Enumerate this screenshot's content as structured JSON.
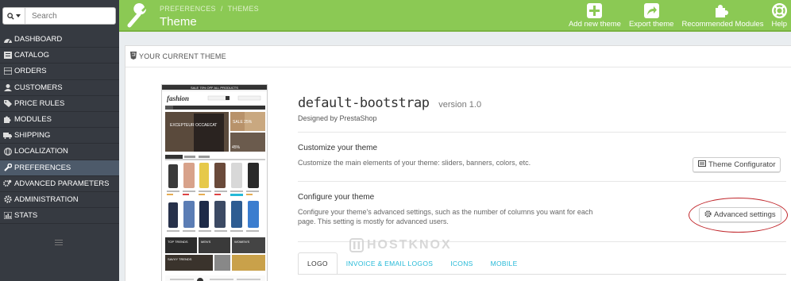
{
  "search": {
    "placeholder": "Search"
  },
  "sidebar": {
    "items": [
      {
        "label": "DASHBOARD",
        "icon": "dashboard-icon"
      },
      {
        "label": "CATALOG",
        "icon": "catalog-icon"
      },
      {
        "label": "ORDERS",
        "icon": "orders-icon"
      },
      {
        "label": "CUSTOMERS",
        "icon": "customers-icon"
      },
      {
        "label": "PRICE RULES",
        "icon": "tag-icon"
      },
      {
        "label": "MODULES",
        "icon": "puzzle-icon"
      },
      {
        "label": "SHIPPING",
        "icon": "truck-icon"
      },
      {
        "label": "LOCALIZATION",
        "icon": "globe-icon"
      },
      {
        "label": "PREFERENCES",
        "icon": "wrench-icon",
        "active": true
      },
      {
        "label": "ADVANCED PARAMETERS",
        "icon": "cogs-icon"
      },
      {
        "label": "ADMINISTRATION",
        "icon": "cog-icon"
      },
      {
        "label": "STATS",
        "icon": "bar-chart-icon"
      }
    ]
  },
  "header": {
    "breadcrumb": [
      "PREFERENCES",
      "THEMES"
    ],
    "title": "Theme",
    "toolbar": [
      {
        "label": "Add new theme",
        "icon": "plus-square-icon"
      },
      {
        "label": "Export theme",
        "icon": "export-icon"
      },
      {
        "label": "Recommended Modules",
        "icon": "puzzle-piece-icon"
      },
      {
        "label": "Help",
        "icon": "lifebuoy-icon"
      }
    ]
  },
  "panel": {
    "heading": "YOUR CURRENT THEME",
    "theme_name": "default-bootstrap",
    "theme_version": "version 1.0",
    "designed_by": "Designed by PrestaShop",
    "customize": {
      "title": "Customize your theme",
      "description": "Customize the main elements of your theme: sliders, banners, colors, etc.",
      "button": "Theme Configurator"
    },
    "configure": {
      "title": "Configure your theme",
      "description": "Configure your theme's advanced settings, such as the number of columns you want for each page. This setting is mostly for advanced users.",
      "button": "Advanced settings"
    },
    "tabs": [
      "LOGO",
      "INVOICE & EMAIL LOGOS",
      "ICONS",
      "MOBILE"
    ]
  },
  "preview": {
    "banner": "SALE 70% OFF ALL PRODUCTS",
    "logo": "fashion",
    "slide_text": "EXCEPTEUR OCCAECAT",
    "sale_badge": "SALE 25%",
    "sale_badge_2": "45%",
    "promo_top": "TOP TRENDS",
    "promo_men": "MEN'S",
    "promo_women": "WOMEN'S",
    "promo_savvy": "SAVVY TRENDS"
  },
  "watermark": "HOSTKNOX",
  "colors": {
    "header_green": "#8bc954",
    "sidebar_bg": "#363a41",
    "sidebar_active": "#4d5a6a",
    "link_blue": "#25b9d7",
    "highlight_red": "#c0262b"
  }
}
